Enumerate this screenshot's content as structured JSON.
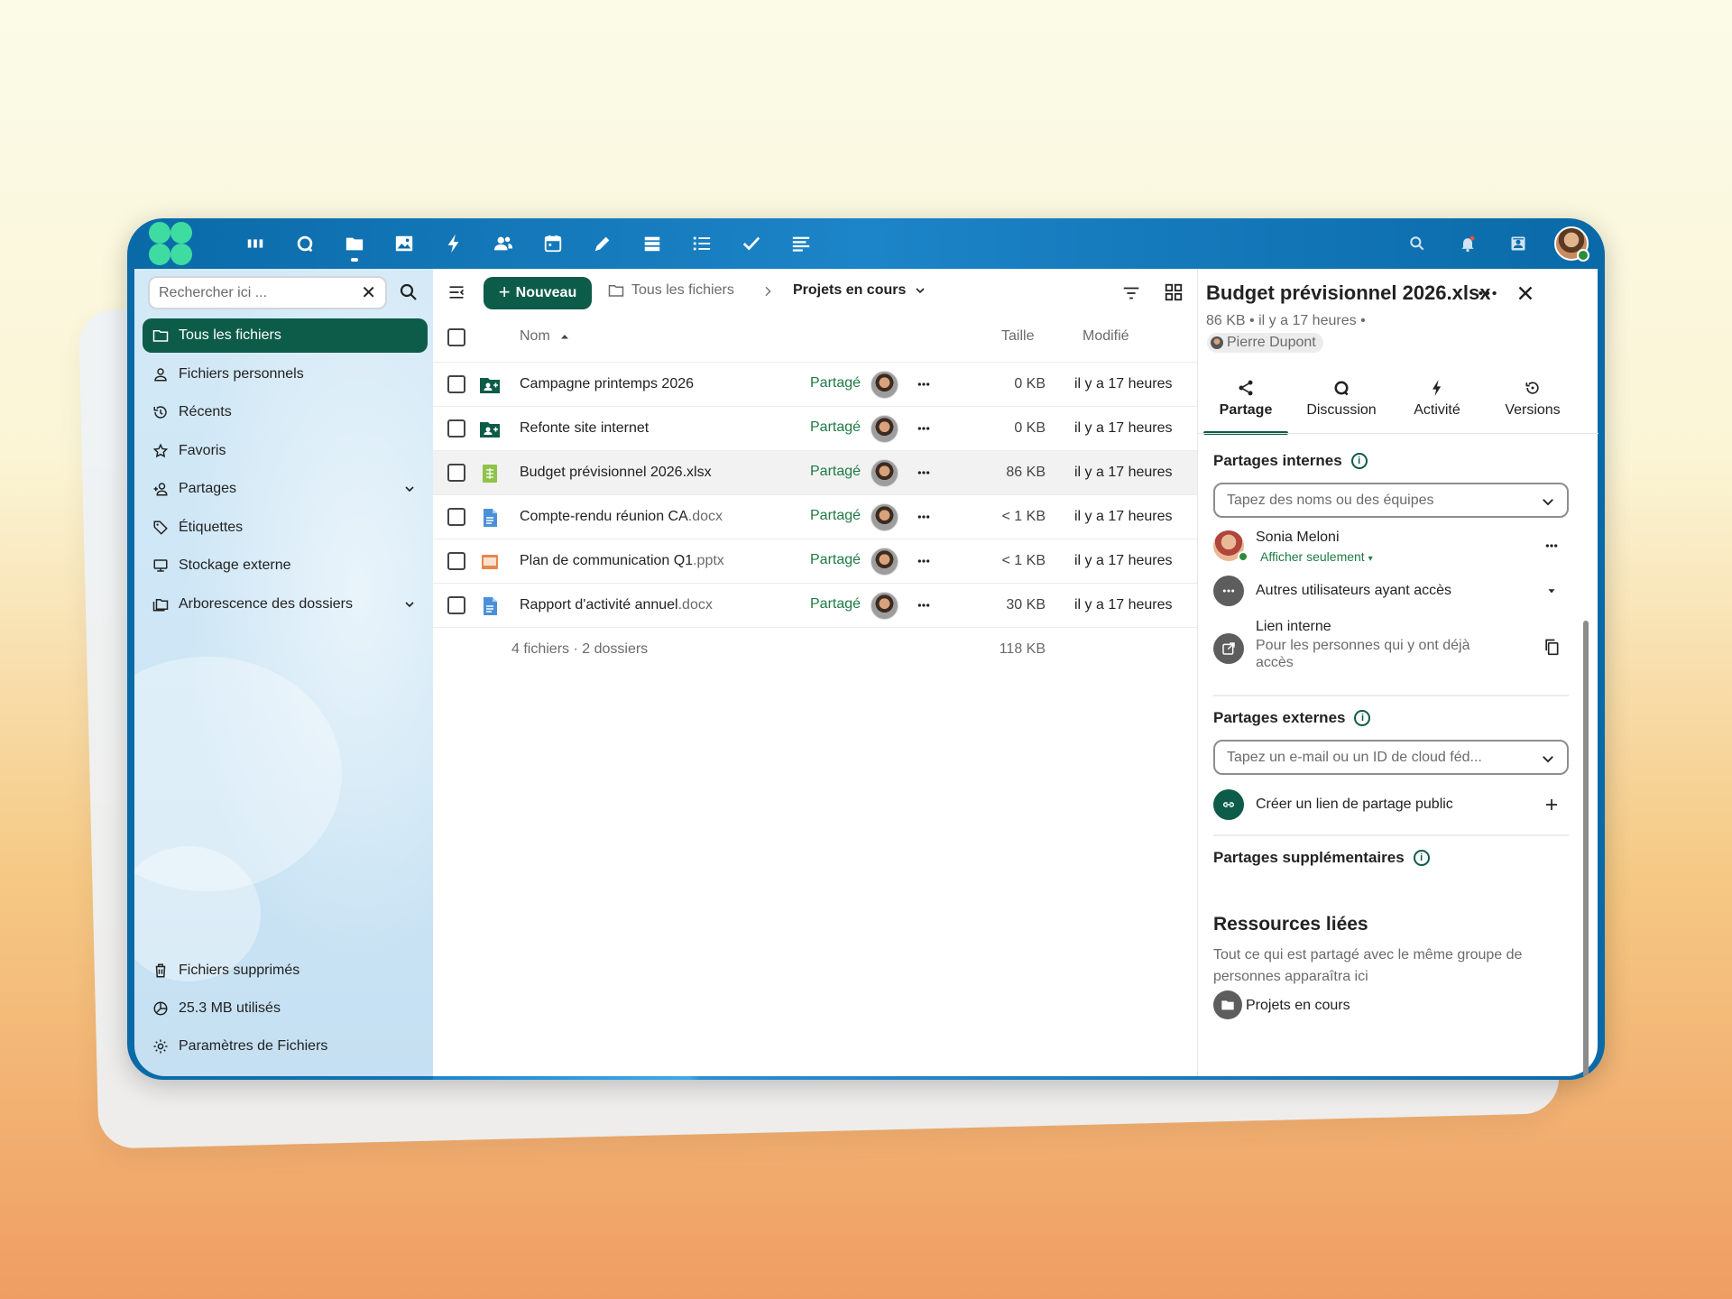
{
  "topbar": {
    "apps": [
      "dashboard",
      "talk",
      "files",
      "photos",
      "activity",
      "contacts",
      "calendar",
      "notes",
      "deck",
      "tasks",
      "checks",
      "text"
    ],
    "active_app": "files"
  },
  "sidebar": {
    "search_placeholder": "Rechercher ici ...",
    "items": [
      {
        "label": "Tous les fichiers",
        "icon": "folder-icon",
        "active": true
      },
      {
        "label": "Fichiers personnels",
        "icon": "user-icon"
      },
      {
        "label": "Récents",
        "icon": "history-icon"
      },
      {
        "label": "Favoris",
        "icon": "star-icon"
      },
      {
        "label": "Partages",
        "icon": "share-user-icon",
        "expandable": true
      },
      {
        "label": "Étiquettes",
        "icon": "tag-icon"
      },
      {
        "label": "Stockage externe",
        "icon": "external-storage-icon"
      },
      {
        "label": "Arborescence des dossiers",
        "icon": "folder-tree-icon",
        "expandable": true
      }
    ],
    "bottom": [
      {
        "label": "Fichiers supprimés",
        "icon": "trash-icon"
      },
      {
        "label": "25.3 MB utilisés",
        "icon": "pie-icon"
      },
      {
        "label": "Paramètres de Fichiers",
        "icon": "gear-icon"
      }
    ]
  },
  "toolbar": {
    "new_label": "Nouveau",
    "crumb_root": "Tous les fichiers",
    "crumb_current": "Projets en cours"
  },
  "table": {
    "col_name": "Nom",
    "col_size": "Taille",
    "col_modified": "Modifié",
    "rows": [
      {
        "name": "Campagne printemps 2026",
        "ext": "",
        "type": "shared-folder",
        "shared": "Partagé",
        "size": "0 KB",
        "modified": "il y a 17 heures"
      },
      {
        "name": "Refonte site internet",
        "ext": "",
        "type": "shared-folder",
        "shared": "Partagé",
        "size": "0 KB",
        "modified": "il y a 17 heures"
      },
      {
        "name": "Budget prévisionnel 2026.xlsx",
        "ext": "",
        "type": "spreadsheet",
        "shared": "Partagé",
        "size": "86 KB",
        "modified": "il y a 17 heures",
        "selected": true
      },
      {
        "name": "Compte-rendu réunion CA",
        "ext": ".docx",
        "type": "document",
        "shared": "Partagé",
        "size": "< 1 KB",
        "modified": "il y a 17 heures"
      },
      {
        "name": "Plan de communication Q1",
        "ext": ".pptx",
        "type": "presentation",
        "shared": "Partagé",
        "size": "< 1 KB",
        "modified": "il y a 17 heures"
      },
      {
        "name": "Rapport d'activité annuel",
        "ext": ".docx",
        "type": "document",
        "shared": "Partagé",
        "size": "30 KB",
        "modified": "il y a 17 heures"
      }
    ],
    "summary_count": "4 fichiers · 2 dossiers",
    "summary_size": "118 KB"
  },
  "details": {
    "title": "Budget prévisionnel 2026.xlsx",
    "size": "86 KB",
    "modified": "il y a 17 heures",
    "owner": "Pierre Dupont",
    "tabs": [
      "Partage",
      "Discussion",
      "Activité",
      "Versions"
    ],
    "internal_title": "Partages internes",
    "internal_placeholder": "Tapez des noms ou des équipes",
    "sharee_name": "Sonia Meloni",
    "sharee_perm": "Afficher seulement",
    "others_label": "Autres utilisateurs ayant accès",
    "internal_link_title": "Lien interne",
    "internal_link_desc": "Pour les personnes qui y ont déjà accès",
    "external_title": "Partages externes",
    "external_placeholder": "Tapez un e-mail ou un ID de cloud féd...",
    "public_link_label": "Créer un lien de partage public",
    "additional_title": "Partages supplémentaires",
    "related_title": "Ressources liées",
    "related_desc": "Tout ce qui est partagé avec le même groupe de personnes apparaîtra ici",
    "related_item": "Projets en cours"
  },
  "colors": {
    "header": "#0a6aa8",
    "primary": "#0d5c49",
    "shared_text": "#1e7a43",
    "logo": "#3fdca2"
  }
}
